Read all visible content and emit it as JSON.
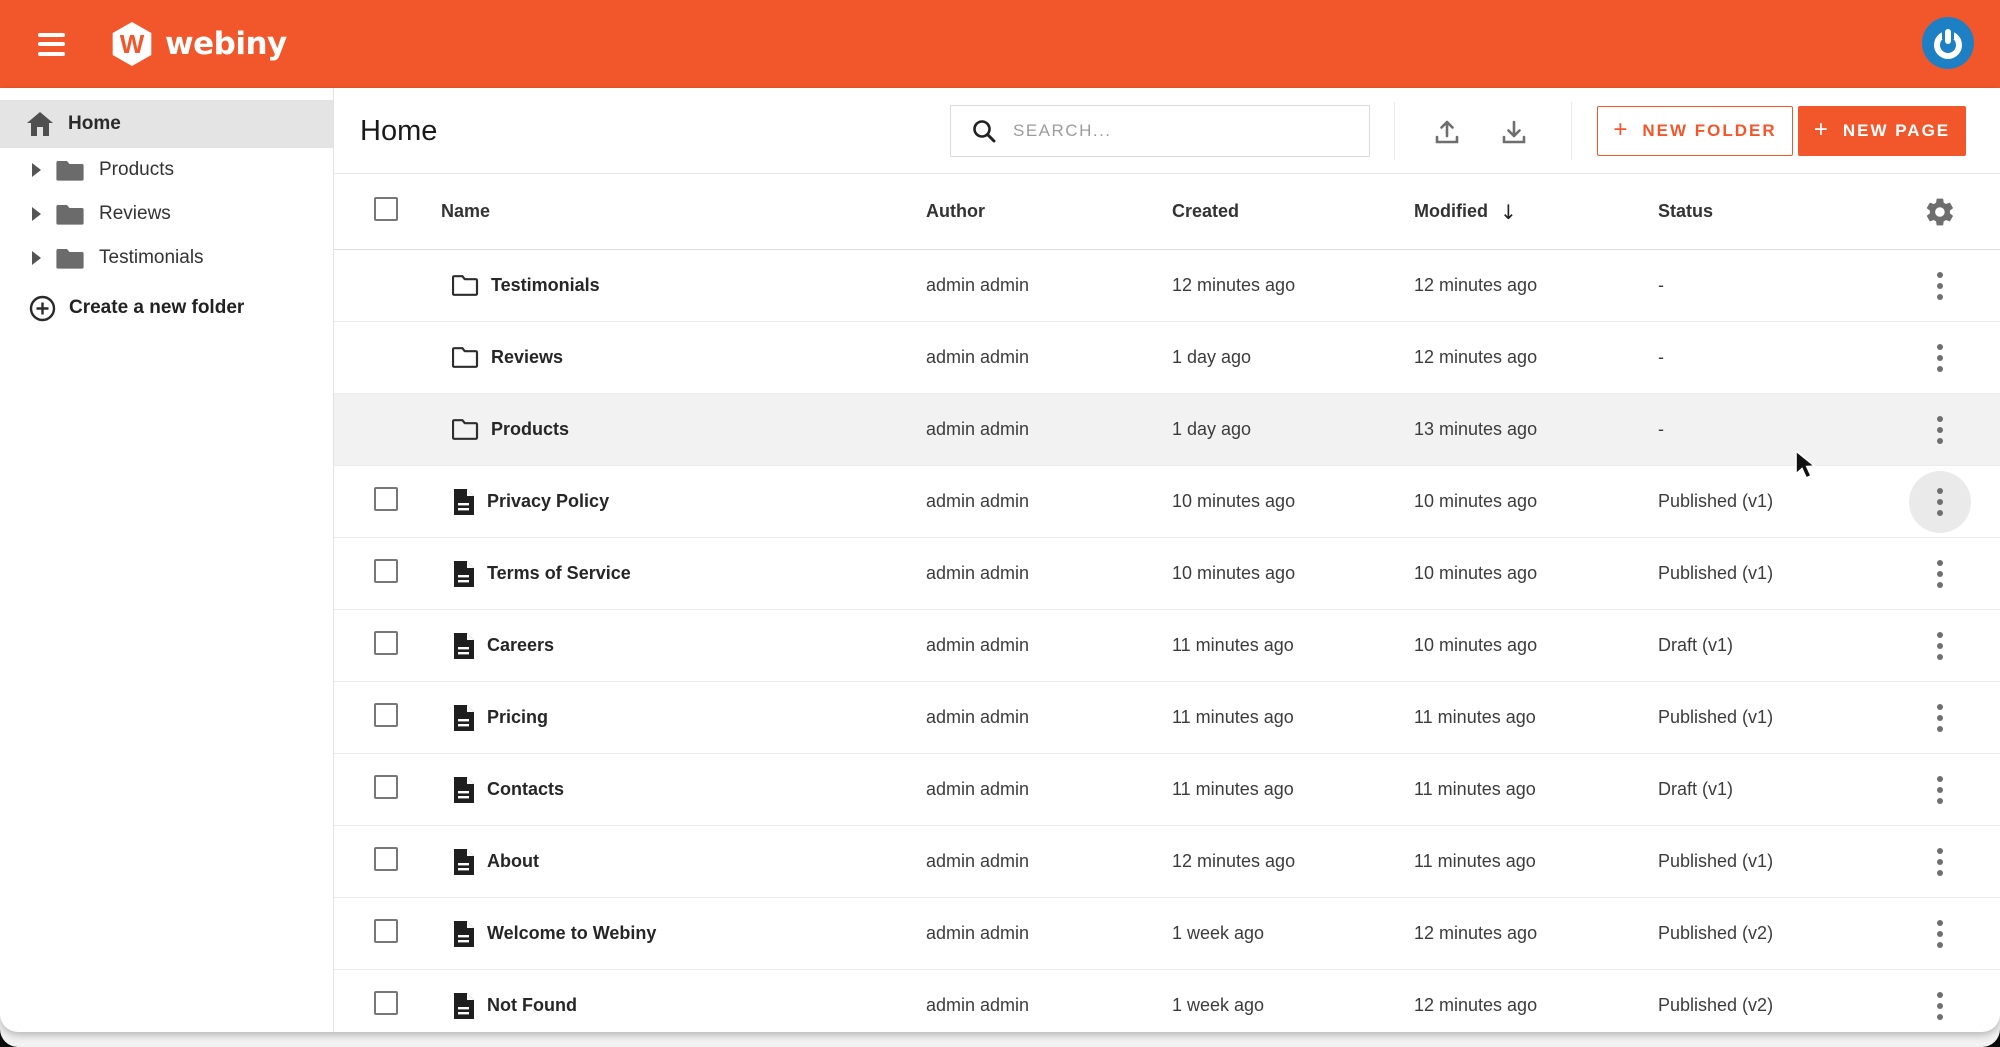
{
  "colors": {
    "accent": "#F2572B",
    "avatar_blue": "#1E80C4",
    "selected_bg": "#E4E4E4",
    "hover_bg": "#F2F2F2"
  },
  "topbar": {
    "brand": "webiny",
    "logo_letter": "W"
  },
  "icons": {
    "plus": "+",
    "sort_desc": "↓"
  },
  "sidebar": {
    "home_label": "Home",
    "folders": [
      {
        "label": "Products"
      },
      {
        "label": "Reviews"
      },
      {
        "label": "Testimonials"
      }
    ],
    "create_folder_label": "Create a new folder"
  },
  "header": {
    "title": "Home",
    "search_placeholder": "SEARCH...",
    "new_folder_label": "NEW FOLDER",
    "new_page_label": "NEW PAGE"
  },
  "table": {
    "columns": {
      "name": "Name",
      "author": "Author",
      "created": "Created",
      "modified": "Modified",
      "status": "Status"
    },
    "rows": [
      {
        "type": "folder",
        "name": "Testimonials",
        "author": "admin admin",
        "created": "12 minutes ago",
        "modified": "12 minutes ago",
        "status": "-"
      },
      {
        "type": "folder",
        "name": "Reviews",
        "author": "admin admin",
        "created": "1 day ago",
        "modified": "12 minutes ago",
        "status": "-"
      },
      {
        "type": "folder",
        "name": "Products",
        "author": "admin admin",
        "created": "1 day ago",
        "modified": "13 minutes ago",
        "status": "-",
        "hovered": true
      },
      {
        "type": "page",
        "name": "Privacy Policy",
        "author": "admin admin",
        "created": "10 minutes ago",
        "modified": "10 minutes ago",
        "status": "Published (v1)",
        "menu_active": true
      },
      {
        "type": "page",
        "name": "Terms of Service",
        "author": "admin admin",
        "created": "10 minutes ago",
        "modified": "10 minutes ago",
        "status": "Published (v1)"
      },
      {
        "type": "page",
        "name": "Careers",
        "author": "admin admin",
        "created": "11 minutes ago",
        "modified": "10 minutes ago",
        "status": "Draft (v1)"
      },
      {
        "type": "page",
        "name": "Pricing",
        "author": "admin admin",
        "created": "11 minutes ago",
        "modified": "11 minutes ago",
        "status": "Published (v1)"
      },
      {
        "type": "page",
        "name": "Contacts",
        "author": "admin admin",
        "created": "11 minutes ago",
        "modified": "11 minutes ago",
        "status": "Draft (v1)"
      },
      {
        "type": "page",
        "name": "About",
        "author": "admin admin",
        "created": "12 minutes ago",
        "modified": "11 minutes ago",
        "status": "Published (v1)"
      },
      {
        "type": "page",
        "name": "Welcome to Webiny",
        "author": "admin admin",
        "created": "1 week ago",
        "modified": "12 minutes ago",
        "status": "Published (v2)"
      },
      {
        "type": "page",
        "name": "Not Found",
        "author": "admin admin",
        "created": "1 week ago",
        "modified": "12 minutes ago",
        "status": "Published (v2)"
      }
    ]
  }
}
